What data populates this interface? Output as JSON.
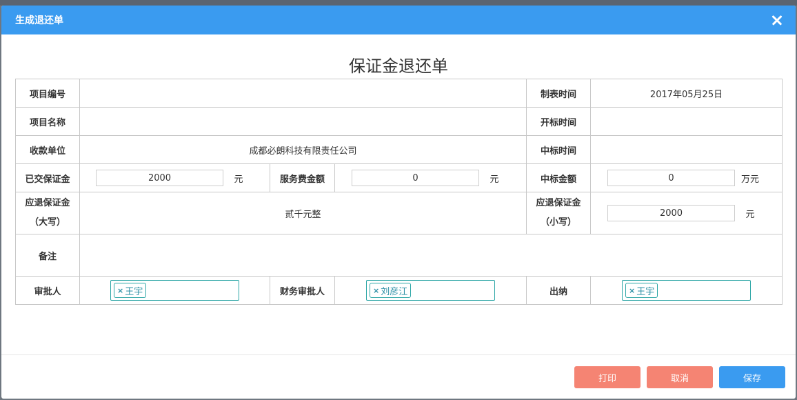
{
  "dialog": {
    "title": "生成退还单",
    "doc_title": "保证金退还单"
  },
  "form": {
    "project_no_label": "项目编号",
    "project_no_value": "",
    "table_time_label": "制表时间",
    "table_time_value": "2017年05月25日",
    "project_name_label": "项目名称",
    "project_name_value": "",
    "open_time_label": "开标时间",
    "open_time_value": "",
    "payee_label": "收款单位",
    "payee_value": "成都必朗科技有限责任公司",
    "award_time_label": "中标时间",
    "award_time_value": "",
    "paid_deposit_label": "已交保证金",
    "paid_deposit_value": "2000",
    "paid_deposit_unit": "元",
    "service_fee_label": "服务费金额",
    "service_fee_value": "0",
    "service_fee_unit": "元",
    "award_amount_label": "中标金额",
    "award_amount_value": "0",
    "award_amount_unit": "万元",
    "refund_upper_label_1": "应退保证金",
    "refund_upper_label_2": "（大写）",
    "refund_upper_value": "贰千元整",
    "refund_lower_label_1": "应退保证金",
    "refund_lower_label_2": "（小写）",
    "refund_lower_value": "2000",
    "refund_lower_unit": "元",
    "remark_label": "备注",
    "remark_value": "",
    "approver_label": "审批人",
    "approver_tag": "王宇",
    "finance_approver_label": "财务审批人",
    "finance_approver_tag": "刘彦江",
    "cashier_label": "出纳",
    "cashier_tag": "王宇"
  },
  "footer": {
    "print_label": "打印",
    "cancel_label": "取消",
    "save_label": "保存"
  },
  "colors": {
    "header": "#3a9bf0",
    "danger_button": "#f58473",
    "primary_button": "#3a9bf0",
    "tag_border": "#2aa5a5"
  },
  "icons": {
    "close": "close-icon",
    "tag_remove": "tag-remove-icon"
  }
}
